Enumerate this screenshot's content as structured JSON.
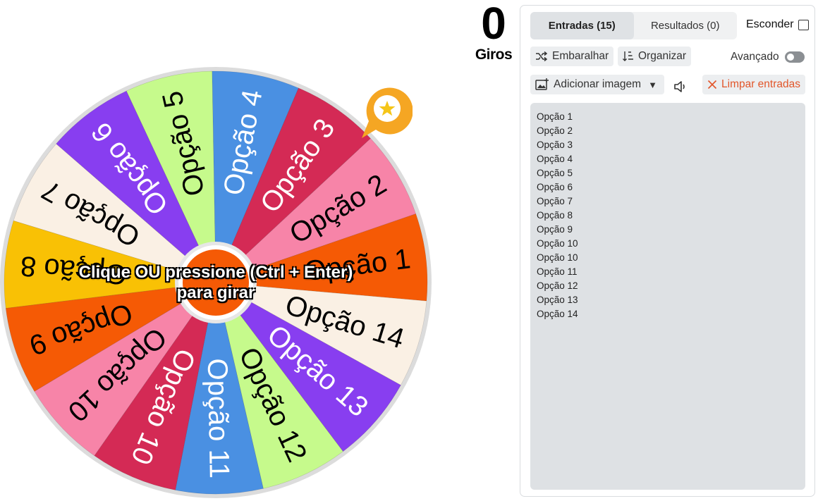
{
  "wheel": {
    "slices": [
      {
        "label": "Opção 1",
        "color": "#f55a05"
      },
      {
        "label": "Opção 2",
        "color": "#f784a8"
      },
      {
        "label": "Opção 3",
        "color": "#d42a55"
      },
      {
        "label": "Opção 4",
        "color": "#4a90e2"
      },
      {
        "label": "Opção 5",
        "color": "#c6fa8c"
      },
      {
        "label": "Opção 6",
        "color": "#883ef0"
      },
      {
        "label": "Opção 7",
        "color": "#faf0e4"
      },
      {
        "label": "Opção 8",
        "color": "#f9c105"
      },
      {
        "label": "Opção 9",
        "color": "#f55a05"
      },
      {
        "label": "Opção 10",
        "color": "#f784a8"
      },
      {
        "label": "Opção 10",
        "color": "#d42a55"
      },
      {
        "label": "Opção 11",
        "color": "#4a90e2"
      },
      {
        "label": "Opção 12",
        "color": "#c6fa8c"
      },
      {
        "label": "Opção 13",
        "color": "#883ef0"
      },
      {
        "label": "Opção 14",
        "color": "#faf0e4"
      }
    ],
    "hub_color": "#f55a05",
    "pointer_color": "#f5a623",
    "spin_hint_line1": "Clique OU pressione (Ctrl + Enter)",
    "spin_hint_line2": "para girar"
  },
  "counter": {
    "value": "0",
    "label": "Giros"
  },
  "panel": {
    "tabs": [
      {
        "label": "Entradas (15)",
        "active": true
      },
      {
        "label": "Resultados (0)",
        "active": false
      }
    ],
    "hide_label": "Esconder",
    "shuffle_label": "Embaralhar",
    "sort_label": "Organizar",
    "advanced_label": "Avançado",
    "add_image_label": "Adicionar imagem",
    "clear_label": "Limpar entradas",
    "entries": [
      "Opção 1",
      "Opção 2",
      "Opção 3",
      "Opção 4",
      "Opção 5",
      "Opção 6",
      "Opção 7",
      "Opção 8",
      "Opção 9",
      "Opção 10",
      "Opção 10",
      "Opção 11",
      "Opção 12",
      "Opção 13",
      "Opção 14"
    ]
  }
}
